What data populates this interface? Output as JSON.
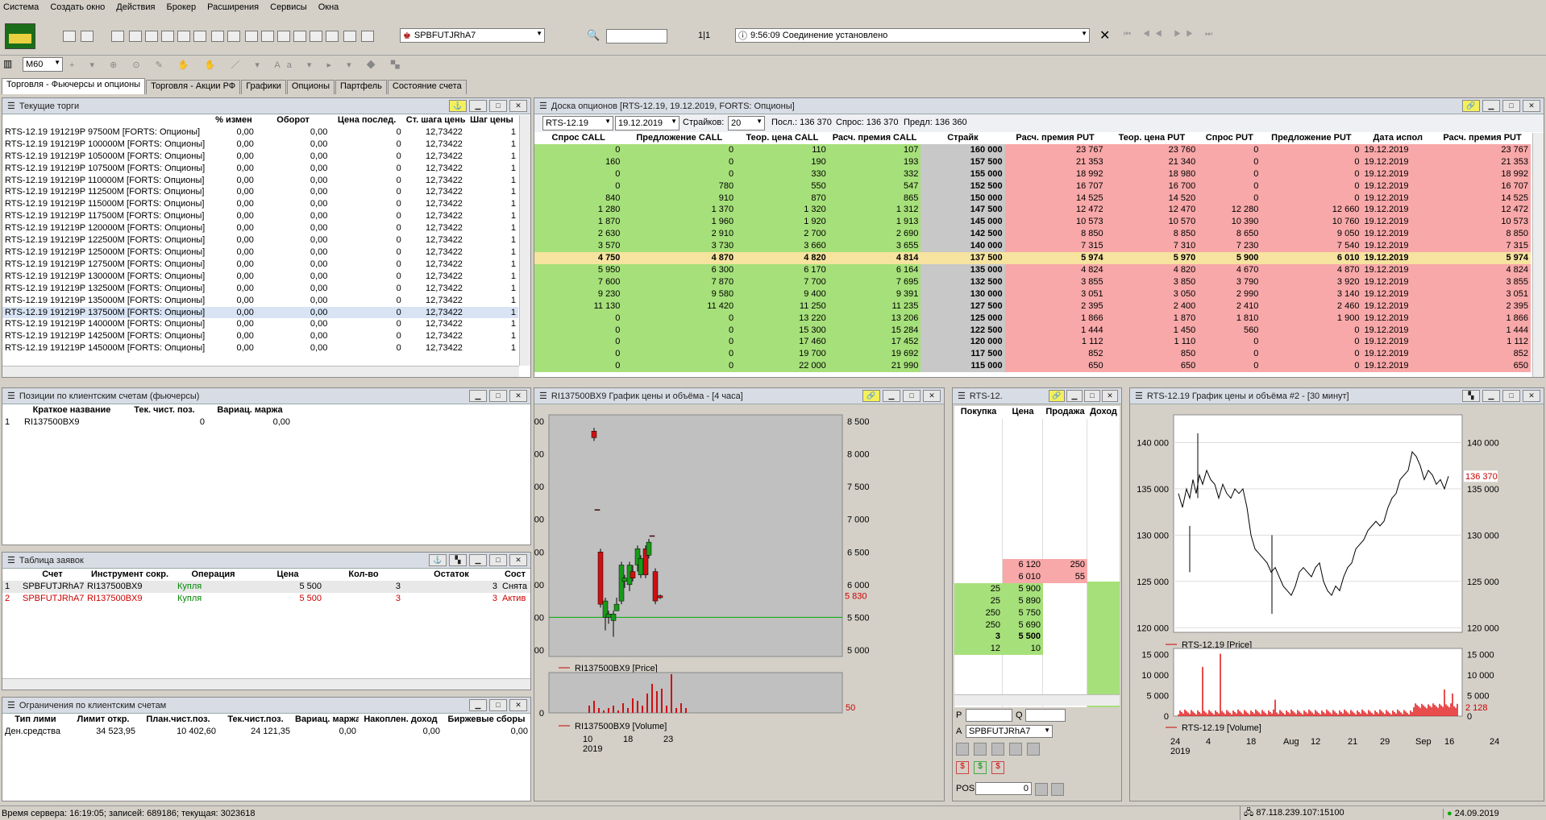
{
  "menu": [
    "Система",
    "Создать окно",
    "Действия",
    "Брокер",
    "Расширения",
    "Сервисы",
    "Окна"
  ],
  "toolbar": {
    "account": "SPBFUTJRhA7",
    "page": "1|1",
    "connection": "9:56:09  Соединение установлено",
    "timeframe": "M60"
  },
  "tabs": [
    "Торговля - Фьючерсы и опционы",
    "Торговля - Акции РФ",
    "Графики",
    "Опционы",
    "Партфель",
    "Состояние счета"
  ],
  "current_trades": {
    "title": "Текущие торги",
    "headers": [
      "",
      "% измен",
      "Оборот",
      "Цена послед.",
      "Ст. шага цены",
      "Шаг цены"
    ],
    "rows": [
      [
        "RTS-12.19  191219P  97500M [FORTS: Опционы]",
        "0,00",
        "0,00",
        "0",
        "12,73422",
        "1"
      ],
      [
        "RTS-12.19  191219P 100000M [FORTS: Опционы]",
        "0,00",
        "0,00",
        "0",
        "12,73422",
        "1"
      ],
      [
        "RTS-12.19  191219P 105000M [FORTS: Опционы]",
        "0,00",
        "0,00",
        "0",
        "12,73422",
        "1"
      ],
      [
        "RTS-12.19  191219P 107500M [FORTS: Опционы]",
        "0,00",
        "0,00",
        "0",
        "12,73422",
        "1"
      ],
      [
        "RTS-12.19  191219P 110000M [FORTS: Опционы]",
        "0,00",
        "0,00",
        "0",
        "12,73422",
        "1"
      ],
      [
        "RTS-12.19  191219P 112500M [FORTS: Опционы]",
        "0,00",
        "0,00",
        "0",
        "12,73422",
        "1"
      ],
      [
        "RTS-12.19  191219P 115000M [FORTS: Опционы]",
        "0,00",
        "0,00",
        "0",
        "12,73422",
        "1"
      ],
      [
        "RTS-12.19  191219P 117500M [FORTS: Опционы]",
        "0,00",
        "0,00",
        "0",
        "12,73422",
        "1"
      ],
      [
        "RTS-12.19  191219P 120000M [FORTS: Опционы]",
        "0,00",
        "0,00",
        "0",
        "12,73422",
        "1"
      ],
      [
        "RTS-12.19  191219P 122500M [FORTS: Опционы]",
        "0,00",
        "0,00",
        "0",
        "12,73422",
        "1"
      ],
      [
        "RTS-12.19  191219P 125000M [FORTS: Опционы]",
        "0,00",
        "0,00",
        "0",
        "12,73422",
        "1"
      ],
      [
        "RTS-12.19  191219P 127500M [FORTS: Опционы]",
        "0,00",
        "0,00",
        "0",
        "12,73422",
        "1"
      ],
      [
        "RTS-12.19  191219P 130000M [FORTS: Опционы]",
        "0,00",
        "0,00",
        "0",
        "12,73422",
        "1"
      ],
      [
        "RTS-12.19  191219P 132500M [FORTS: Опционы]",
        "0,00",
        "0,00",
        "0",
        "12,73422",
        "1"
      ],
      [
        "RTS-12.19  191219P 135000M [FORTS: Опционы]",
        "0,00",
        "0,00",
        "0",
        "12,73422",
        "1"
      ],
      [
        "RTS-12.19  191219P 137500M [FORTS: Опционы]",
        "0,00",
        "0,00",
        "0",
        "12,73422",
        "1"
      ],
      [
        "RTS-12.19  191219P 140000M [FORTS: Опционы]",
        "0,00",
        "0,00",
        "0",
        "12,73422",
        "1"
      ],
      [
        "RTS-12.19  191219P 142500M [FORTS: Опционы]",
        "0,00",
        "0,00",
        "0",
        "12,73422",
        "1"
      ],
      [
        "RTS-12.19  191219P 145000M [FORTS: Опционы]",
        "0,00",
        "0,00",
        "0",
        "12,73422",
        "1"
      ]
    ]
  },
  "options_board": {
    "title": "Доска опционов [RTS-12.19, 19.12.2019, FORTS: Опционы]",
    "instrument": "RTS-12.19",
    "date": "19.12.2019",
    "strikes_label": "Страйков:",
    "strikes": "20",
    "last": "Посл.: 136 370",
    "bid": "Спрос: 136 370",
    "prev": "Предл: 136 360",
    "headers": [
      "Спрос CALL",
      "Предложение CALL",
      "Теор. цена CALL",
      "Расч. премия CALL",
      "Страйк",
      "Расч. премия PUT",
      "Теор. цена PUT",
      "Спрос PUT",
      "Предложение PUT",
      "Дата испол",
      "Расч. премия PUT"
    ],
    "rows": [
      [
        "0",
        "0",
        "110",
        "107",
        "160 000",
        "23 767",
        "23 760",
        "0",
        "0",
        "19.12.2019",
        "23 767"
      ],
      [
        "160",
        "0",
        "190",
        "193",
        "157 500",
        "21 353",
        "21 340",
        "0",
        "0",
        "19.12.2019",
        "21 353"
      ],
      [
        "0",
        "0",
        "330",
        "332",
        "155 000",
        "18 992",
        "18 980",
        "0",
        "0",
        "19.12.2019",
        "18 992"
      ],
      [
        "0",
        "780",
        "550",
        "547",
        "152 500",
        "16 707",
        "16 700",
        "0",
        "0",
        "19.12.2019",
        "16 707"
      ],
      [
        "840",
        "910",
        "870",
        "865",
        "150 000",
        "14 525",
        "14 520",
        "0",
        "0",
        "19.12.2019",
        "14 525"
      ],
      [
        "1 280",
        "1 370",
        "1 320",
        "1 312",
        "147 500",
        "12 472",
        "12 470",
        "12 280",
        "12 660",
        "19.12.2019",
        "12 472"
      ],
      [
        "1 870",
        "1 960",
        "1 920",
        "1 913",
        "145 000",
        "10 573",
        "10 570",
        "10 390",
        "10 760",
        "19.12.2019",
        "10 573"
      ],
      [
        "2 630",
        "2 910",
        "2 700",
        "2 690",
        "142 500",
        "8 850",
        "8 850",
        "8 650",
        "9 050",
        "19.12.2019",
        "8 850"
      ],
      [
        "3 570",
        "3 730",
        "3 660",
        "3 655",
        "140 000",
        "7 315",
        "7 310",
        "7 230",
        "7 540",
        "19.12.2019",
        "7 315"
      ],
      [
        "4 750",
        "4 870",
        "4 820",
        "4 814",
        "137 500",
        "5 974",
        "5 970",
        "5 900",
        "6 010",
        "19.12.2019",
        "5 974"
      ],
      [
        "5 950",
        "6 300",
        "6 170",
        "6 164",
        "135 000",
        "4 824",
        "4 820",
        "4 670",
        "4 870",
        "19.12.2019",
        "4 824"
      ],
      [
        "7 600",
        "7 870",
        "7 700",
        "7 695",
        "132 500",
        "3 855",
        "3 850",
        "3 790",
        "3 920",
        "19.12.2019",
        "3 855"
      ],
      [
        "9 230",
        "9 580",
        "9 400",
        "9 391",
        "130 000",
        "3 051",
        "3 050",
        "2 990",
        "3 140",
        "19.12.2019",
        "3 051"
      ],
      [
        "11 130",
        "11 420",
        "11 250",
        "11 235",
        "127 500",
        "2 395",
        "2 400",
        "2 410",
        "2 460",
        "19.12.2019",
        "2 395"
      ],
      [
        "0",
        "0",
        "13 220",
        "13 206",
        "125 000",
        "1 866",
        "1 870",
        "1 810",
        "1 900",
        "19.12.2019",
        "1 866"
      ],
      [
        "0",
        "0",
        "15 300",
        "15 284",
        "122 500",
        "1 444",
        "1 450",
        "560",
        "0",
        "19.12.2019",
        "1 444"
      ],
      [
        "0",
        "0",
        "17 460",
        "17 452",
        "120 000",
        "1 112",
        "1 110",
        "0",
        "0",
        "19.12.2019",
        "1 112"
      ],
      [
        "0",
        "0",
        "19 700",
        "19 692",
        "117 500",
        "852",
        "850",
        "0",
        "0",
        "19.12.2019",
        "852"
      ],
      [
        "0",
        "0",
        "22 000",
        "21 990",
        "115 000",
        "650",
        "650",
        "0",
        "0",
        "19.12.2019",
        "650"
      ]
    ]
  },
  "positions": {
    "title": "Позиции по клиентским счетам (фьючерсы)",
    "headers": [
      "",
      "Краткое название",
      "Тек. чист. поз.",
      "Вариац. маржа"
    ],
    "rows": [
      [
        "1",
        "RI137500BX9",
        "0",
        "0,00"
      ]
    ]
  },
  "orders": {
    "title": "Таблица заявок",
    "headers": [
      "",
      "Счет",
      "Инструмент сокр.",
      "Операция",
      "Цена",
      "Кол-во",
      "Остаток",
      "Сост"
    ],
    "rows": [
      [
        "1",
        "SPBFUTJRhA7",
        "RI137500BX9",
        "Купля",
        "5 500",
        "3",
        "3",
        "Снята"
      ],
      [
        "2",
        "SPBFUTJRhA7",
        "RI137500BX9",
        "Купля",
        "5 500",
        "3",
        "3",
        "Актив"
      ]
    ]
  },
  "limits": {
    "title": "Ограничения по клиентским счетам",
    "headers": [
      "Тип лими",
      "Лимит откр.",
      "План.чист.поз.",
      "Тек.чист.поз.",
      "Вариац. маржа",
      "Накоплен. доход",
      "Биржевые сборы"
    ],
    "rows": [
      [
        "Ден.средства",
        "34 523,95",
        "10 402,60",
        "24 121,35",
        "0,00",
        "0,00",
        "0,00"
      ]
    ]
  },
  "chart1": {
    "title": "RI137500BX9 График цены и объёма - [4 часа]",
    "price_legend": "RI137500BX9 [Price]",
    "vol_legend": "RI137500BX9 [Volume]",
    "last_label": "5 830",
    "vol_label": "50",
    "year": "2019",
    "y_ticks": [
      "8 500",
      "8 000",
      "7 500",
      "7 000",
      "6 500",
      "6 000",
      "5 500",
      "5 000"
    ],
    "x_ticks": [
      "10",
      "18",
      "23"
    ]
  },
  "depth": {
    "title": "RTS-12.",
    "headers": [
      "Покупка",
      "Цена",
      "Продажа",
      "Доход"
    ],
    "rows": [
      [
        "",
        "6 120",
        "250"
      ],
      [
        "",
        "6 010",
        "55"
      ],
      [
        "25",
        "5 900",
        ""
      ],
      [
        "25",
        "5 890",
        ""
      ],
      [
        "250",
        "5 750",
        ""
      ],
      [
        "250",
        "5 690",
        ""
      ],
      [
        "3",
        "5 500",
        ""
      ],
      [
        "12",
        "10",
        ""
      ]
    ],
    "p_label": "P",
    "q_label": "Q",
    "a_label": "A",
    "account": "SPBFUTJRhA7",
    "pos_label": "POS.",
    "pos_value": "0"
  },
  "chart2": {
    "title": "RTS-12.19 График цены и объёма #2 - [30 минут]",
    "price_legend": "RTS-12.19 [Price]",
    "vol_legend": "RTS-12.19 [Volume]",
    "last_label": "136 370",
    "vol_label": "2 128",
    "year": "2019",
    "y_ticks": [
      "140 000",
      "135 000",
      "130 000",
      "125 000",
      "120 000"
    ],
    "v_ticks": [
      "15 000",
      "10 000",
      "5 000",
      "0"
    ],
    "x_ticks": [
      "24",
      "4",
      "18",
      "Aug",
      "12",
      "21",
      "29",
      "Sep",
      "16",
      "24"
    ]
  },
  "status": {
    "text": "Время сервера: 16:19:05; записей: 689186; текущая: 3023618",
    "ip": "87.118.239.107:15100",
    "date": "24.09.2019"
  }
}
